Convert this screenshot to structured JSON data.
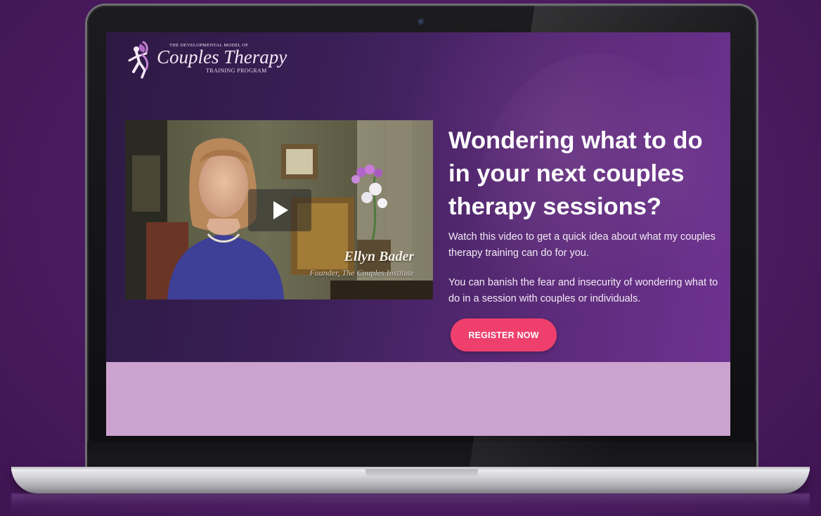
{
  "logo": {
    "small_text": "THE DEVELOPMENTAL MODEL OF",
    "title": "Couples Therapy",
    "subtitle": "TRAINING PROGRAM"
  },
  "video": {
    "speaker_name": "Ellyn Bader",
    "speaker_title": "Founder, The Couples Institute",
    "play_icon": "play-icon"
  },
  "hero": {
    "headline": "Wondering what to do in your next couples therapy sessions?",
    "paragraph_1": "Watch this video to get a quick idea about what my couples therapy training can do for you.",
    "paragraph_2": "You can banish the fear and insecurity of wondering what to do in a session with couples or individuals.",
    "cta_label": "REGISTER NOW"
  },
  "colors": {
    "background": "#4a1a5e",
    "hero_gradient_start": "#2d1a44",
    "hero_gradient_end": "#6e3290",
    "lower_band": "#cba3ce",
    "cta": "#ef3f6c"
  }
}
